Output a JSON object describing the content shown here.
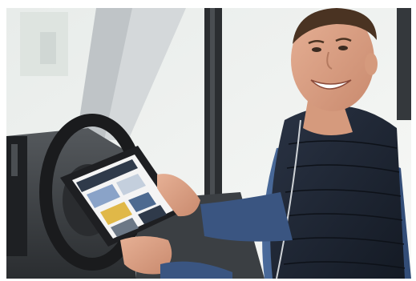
{
  "scene": {
    "subject": "man-with-tablet",
    "colors": {
      "background": "#ffffff",
      "window": "#eef0ee",
      "cab-interior": "#3a3d40",
      "pillar": "#c9cdd0",
      "skin": "#e2a98a",
      "vest": "#1d2430",
      "sleeve": "#3e5a86",
      "tablet": "#1e1f22"
    }
  }
}
